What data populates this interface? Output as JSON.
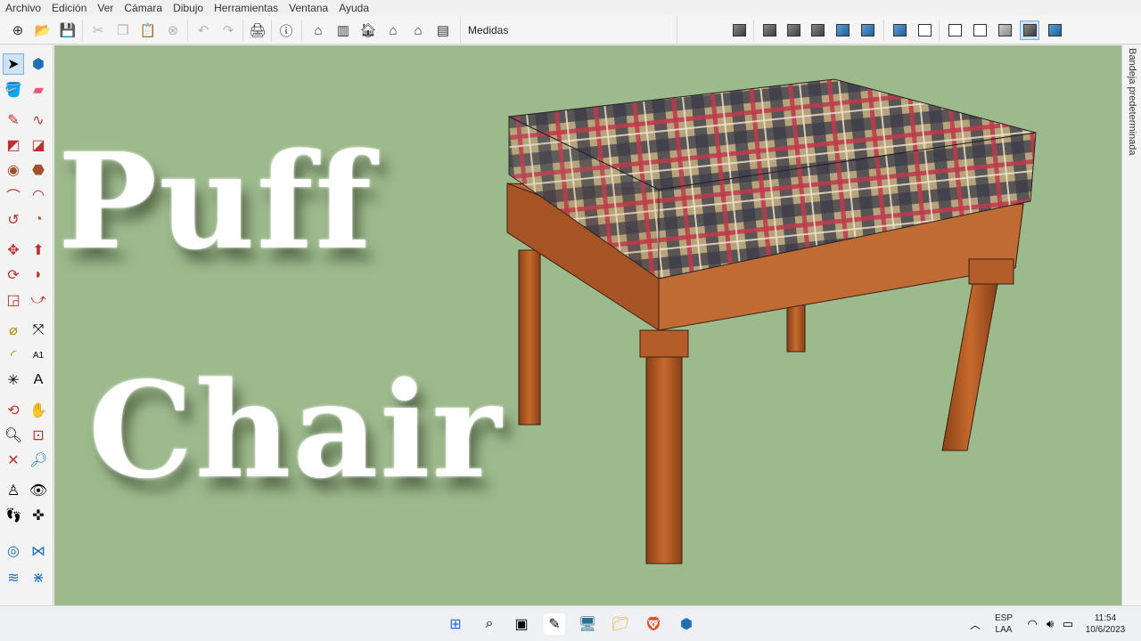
{
  "menu": [
    "Archivo",
    "Edición",
    "Ver",
    "Cámara",
    "Dibujo",
    "Herramientas",
    "Ventana",
    "Ayuda"
  ],
  "toolbar": {
    "measure_label": "Medidas",
    "icons": [
      "new-icon",
      "open-icon",
      "save-icon",
      "cut-icon",
      "copy-icon",
      "paste-icon",
      "erase-icon",
      "undo-icon",
      "redo-icon",
      "print-icon",
      "model-info-icon",
      "warehouse-icon",
      "components-icon",
      "home-icon",
      "extension-warehouse-icon",
      "house-outline-icon",
      "layout-icon"
    ]
  },
  "viewport": {
    "title_line1": "Puff",
    "title_line2": "Chair"
  },
  "tray": {
    "label": "Bandeja predeterminada"
  },
  "taskbar": {
    "lang": "ESP",
    "layout": "LAA",
    "time": "11:54",
    "date": "10/6/2023"
  },
  "colors": {
    "viewport_bg": "#9dba8d",
    "wood": "#b5602a",
    "plaid_base": "#b7a47c",
    "plaid_red": "#c0394b",
    "plaid_dark": "#3a3a48"
  }
}
